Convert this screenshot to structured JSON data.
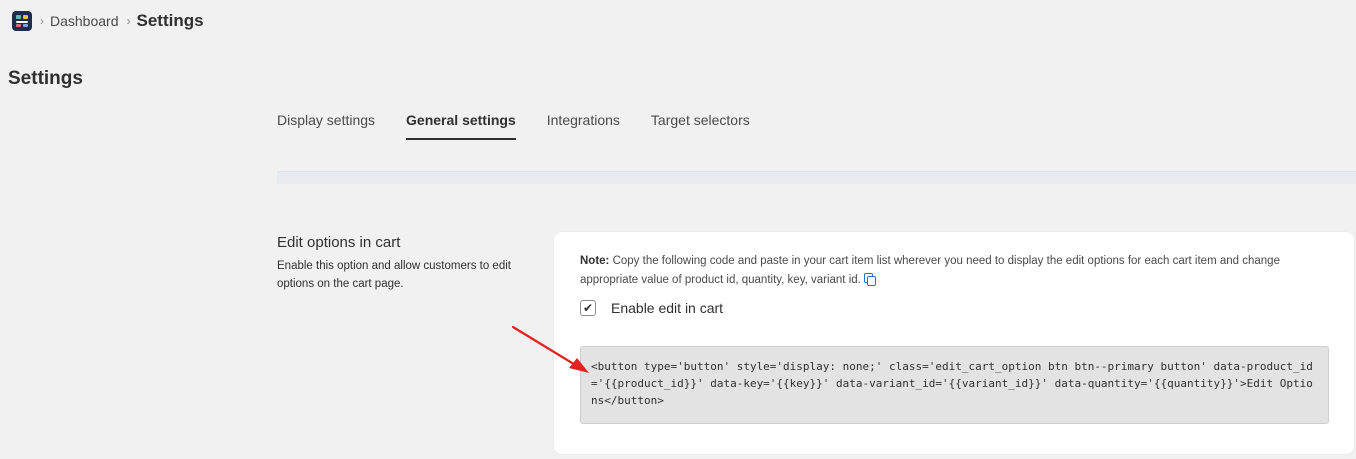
{
  "breadcrumb": {
    "app_icon": "app-grid-icon",
    "separator": "›",
    "dashboard": "Dashboard",
    "current": "Settings"
  },
  "page": {
    "title": "Settings"
  },
  "tabs": [
    {
      "label": "Display settings",
      "active": false
    },
    {
      "label": "General settings",
      "active": true
    },
    {
      "label": "Integrations",
      "active": false
    },
    {
      "label": "Target selectors",
      "active": false
    }
  ],
  "section": {
    "title": "Edit options in cart",
    "description": "Enable this option and allow customers to edit options on the cart page."
  },
  "card": {
    "note_label": "Note:",
    "note_text": " Copy the following code and paste in your cart item list wherever you need to display the edit options for each cart item and change appropriate value of product id, quantity, key, variant id.",
    "copy_icon": "copy-icon",
    "checkbox_checked": true,
    "checkbox_mark": "✔",
    "checkbox_label": "Enable edit in cart",
    "code": "<button type='button' style='display: none;' class='edit_cart_option btn btn--primary button' data-product_id='{{product_id}}' data-key='{{key}}' data-variant_id='{{variant_id}}' data-quantity='{{quantity}}'>Edit Options</button>"
  },
  "colors": {
    "background": "#f1f1f1",
    "card": "#ffffff",
    "code_bg": "#e3e3e3",
    "arrow": "#e32222",
    "link": "#2c6ecb"
  }
}
